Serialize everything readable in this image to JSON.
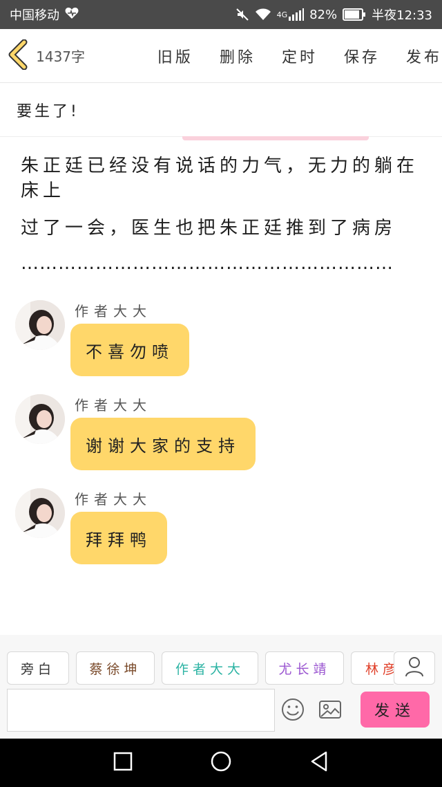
{
  "status_bar": {
    "carrier": "中国移动",
    "network": "4G",
    "battery": "82%",
    "time": "半夜12:33"
  },
  "header": {
    "word_count": "1437字",
    "actions": [
      "旧版",
      "删除",
      "定时",
      "保存",
      "发布"
    ]
  },
  "chapter_title": "要生了!",
  "story": {
    "paragraphs": [
      "朱正廷已经没有说话的力气，无力的躺在床上",
      "过了一会，医生也把朱正廷推到了病房"
    ],
    "ellipsis": "……………………………………………………"
  },
  "messages": [
    {
      "author": "作者大大",
      "text": "不喜勿喷"
    },
    {
      "author": "作者大大",
      "text": "谢谢大家的支持"
    },
    {
      "author": "作者大大",
      "text": "拜拜鸭"
    }
  ],
  "roles": [
    {
      "label": "旁白",
      "color": "#333333"
    },
    {
      "label": "蔡徐坤",
      "color": "#7a4a2a"
    },
    {
      "label": "作者大大",
      "color": "#2bb3a3"
    },
    {
      "label": "尤长靖",
      "color": "#9a55d0"
    },
    {
      "label": "林彦俊",
      "color": "#e0402a"
    }
  ],
  "input": {
    "placeholder": "",
    "value": ""
  },
  "send_label": "发送",
  "icons": {
    "back": "back-chevron-icon",
    "emoji": "emoji-icon",
    "image": "image-icon",
    "person": "person-icon",
    "accent": "#ffd76a",
    "send_color": "#ff69a8"
  }
}
